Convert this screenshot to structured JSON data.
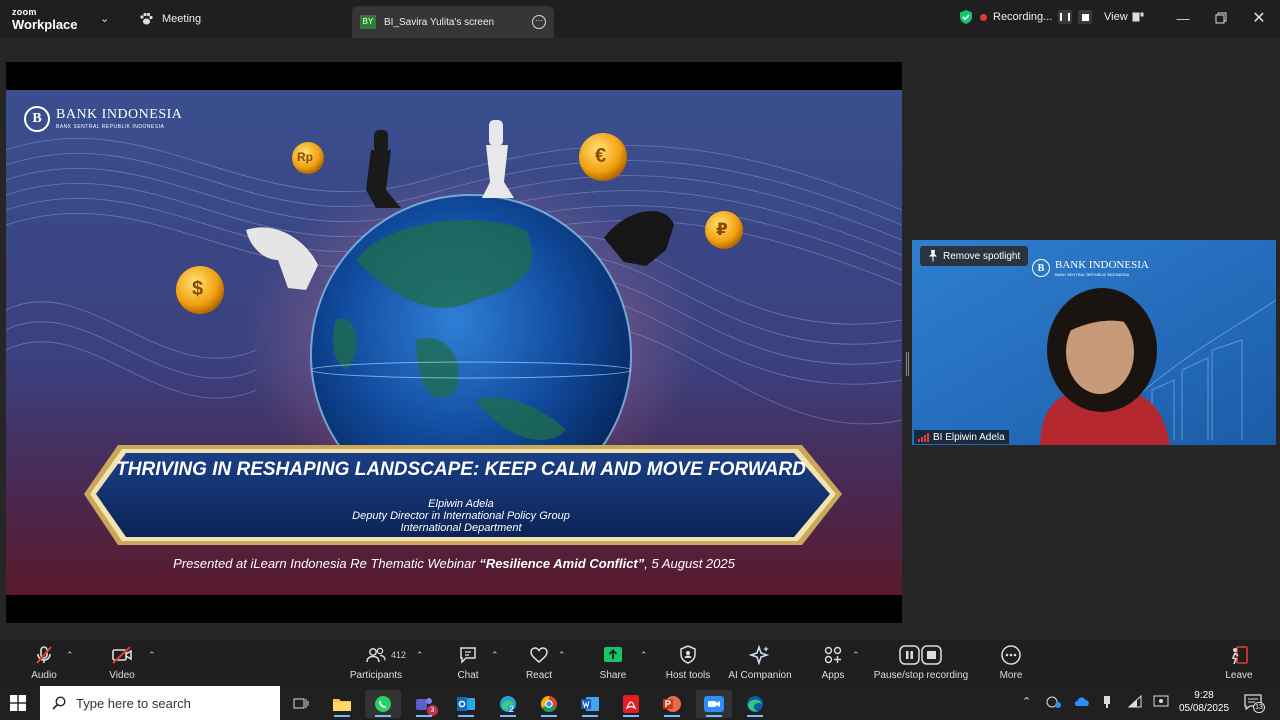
{
  "titlebar": {
    "logo_top": "zoom",
    "logo_bottom": "Workplace",
    "meeting_label": "Meeting",
    "screen_badge": "BY",
    "screen_tab_label": "BI_Savira Yulita's screen",
    "recording_label": "Recording...",
    "view_label": "View"
  },
  "slide": {
    "logo_title": "BANK INDONESIA",
    "logo_subtitle": "BANK SENTRAL REPUBLIK INDONESIA",
    "title": "THRIVING IN RESHAPING LANDSCAPE: KEEP CALM AND MOVE FORWARD",
    "presenter_name": "Elpiwin Adela",
    "presenter_role": "Deputy Director in International Policy Group",
    "presenter_dept": "International Department",
    "presented_prefix": "Presented at iLearn Indonesia Re Thematic Webinar ",
    "presented_event": "“Resilience Amid Conflict”",
    "presented_date": ", 5 August 2025",
    "coin_rp": "Rp",
    "coin_euro": "€",
    "coin_dollar": "$",
    "coin_ruble": "₽"
  },
  "video_tile": {
    "spotlight_label": "Remove spotlight",
    "logo_title": "BANK INDONESIA",
    "logo_subtitle": "BANK SENTRAL REPUBLIK INDONESIA",
    "participant_name": "BI Elpiwin Adela"
  },
  "toolbar": {
    "audio": "Audio",
    "video": "Video",
    "participants": "Participants",
    "participants_count": "412",
    "chat": "Chat",
    "react": "React",
    "share": "Share",
    "host_tools": "Host tools",
    "ai_companion": "AI Companion",
    "apps": "Apps",
    "pause_stop": "Pause/stop recording",
    "more": "More",
    "leave": "Leave"
  },
  "taskbar": {
    "search_placeholder": "Type here to search",
    "time": "9:28",
    "date": "05/08/2025",
    "notification_count": "13",
    "teams_badge": "3",
    "edge_badge": "2"
  },
  "colors": {
    "accent_green": "#16c46a",
    "record_red": "#e53935",
    "banner_blue": "#0f2d63",
    "gold": "#d8b66a"
  }
}
